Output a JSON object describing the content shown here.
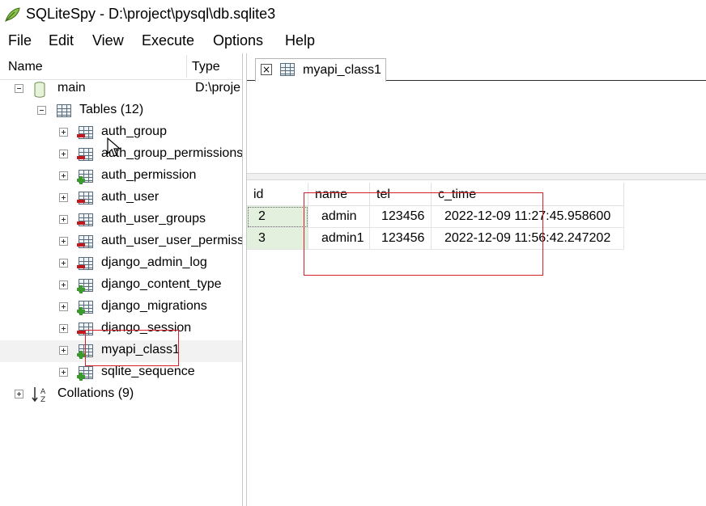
{
  "window": {
    "title": "SQLiteSpy - D:\\project\\pysql\\db.sqlite3",
    "app_icon": "feather-icon"
  },
  "menu": [
    "File",
    "Edit",
    "View",
    "Execute",
    "Options",
    "Help"
  ],
  "tree": {
    "header": {
      "name": "Name",
      "type": "Type"
    },
    "db": {
      "label": "main",
      "type": "D:\\proje"
    },
    "tables_label": "Tables (12)",
    "tables": [
      {
        "label": "auth_group",
        "mark": "red"
      },
      {
        "label": "auth_group_permissions",
        "mark": "red"
      },
      {
        "label": "auth_permission",
        "mark": "green"
      },
      {
        "label": "auth_user",
        "mark": "red"
      },
      {
        "label": "auth_user_groups",
        "mark": "red"
      },
      {
        "label": "auth_user_user_permiss",
        "mark": "red"
      },
      {
        "label": "django_admin_log",
        "mark": "red"
      },
      {
        "label": "django_content_type",
        "mark": "green"
      },
      {
        "label": "django_migrations",
        "mark": "green"
      },
      {
        "label": "django_session",
        "mark": "red"
      },
      {
        "label": "myapi_class1",
        "mark": "green",
        "selected": true
      },
      {
        "label": "sqlite_sequence",
        "mark": "green"
      }
    ],
    "collations_label": "Collations (9)"
  },
  "tab": {
    "label": "myapi_class1",
    "close_glyph": "×"
  },
  "sql_editor": {
    "value": ""
  },
  "result": {
    "columns": [
      "id",
      "name",
      "tel",
      "c_time"
    ],
    "rows": [
      [
        "2",
        "admin",
        "123456",
        "2022-12-09 11:27:45.958600"
      ],
      [
        "3",
        "admin1",
        "123456",
        "2022-12-09 11:56:42.247202"
      ]
    ]
  },
  "colors": {
    "annotation": "#d8202a",
    "id_cell_bg": "#e3f0dd",
    "table_mark_red": "#c0191e",
    "table_mark_green": "#3a9a2a"
  }
}
